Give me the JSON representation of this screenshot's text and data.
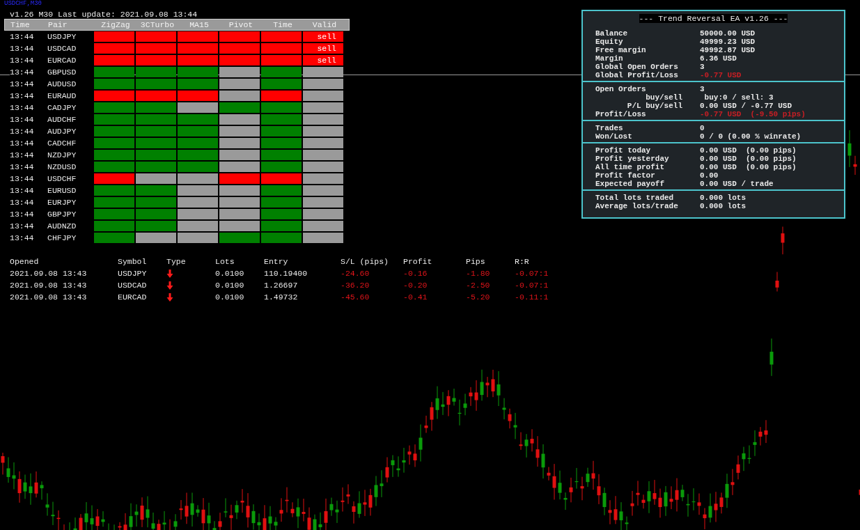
{
  "chart": {
    "symbol": "USDCHF,M30"
  },
  "signals": {
    "status": "v1.26 M30 Last update: 2021.09.08 13:44",
    "columns": [
      "Time",
      "Pair",
      "ZigZag",
      "3CTurbo",
      "MA15",
      "Pivot",
      "Time",
      "Valid"
    ],
    "rows": [
      {
        "time": "13:44",
        "pair": "USDJPY",
        "cells": [
          {
            "color": "#ff0000"
          },
          {
            "color": "#ff0000"
          },
          {
            "color": "#ff0000"
          },
          {
            "color": "#ff0000"
          },
          {
            "color": "#ff0000"
          }
        ],
        "valid": {
          "color": "#ff0000",
          "label": "sell"
        }
      },
      {
        "time": "13:44",
        "pair": "USDCAD",
        "cells": [
          {
            "color": "#ff0000"
          },
          {
            "color": "#ff0000"
          },
          {
            "color": "#ff0000"
          },
          {
            "color": "#ff0000"
          },
          {
            "color": "#ff0000"
          }
        ],
        "valid": {
          "color": "#ff0000",
          "label": "sell"
        }
      },
      {
        "time": "13:44",
        "pair": "EURCAD",
        "cells": [
          {
            "color": "#ff0000"
          },
          {
            "color": "#ff0000"
          },
          {
            "color": "#ff0000"
          },
          {
            "color": "#ff0000"
          },
          {
            "color": "#ff0000"
          }
        ],
        "valid": {
          "color": "#ff0000",
          "label": "sell"
        }
      },
      {
        "time": "13:44",
        "pair": "GBPUSD",
        "cells": [
          {
            "color": "#008000"
          },
          {
            "color": "#008000"
          },
          {
            "color": "#008000"
          },
          {
            "color": "#9a9a9a"
          },
          {
            "color": "#008000"
          }
        ],
        "valid": {
          "color": "#9a9a9a"
        }
      },
      {
        "time": "13:44",
        "pair": "AUDUSD",
        "cells": [
          {
            "color": "#008000"
          },
          {
            "color": "#008000"
          },
          {
            "color": "#008000"
          },
          {
            "color": "#9a9a9a"
          },
          {
            "color": "#008000"
          }
        ],
        "valid": {
          "color": "#9a9a9a"
        }
      },
      {
        "time": "13:44",
        "pair": "EURAUD",
        "cells": [
          {
            "color": "#ff0000"
          },
          {
            "color": "#ff0000"
          },
          {
            "color": "#ff0000"
          },
          {
            "color": "#9a9a9a"
          },
          {
            "color": "#ff0000"
          }
        ],
        "valid": {
          "color": "#9a9a9a"
        }
      },
      {
        "time": "13:44",
        "pair": "CADJPY",
        "cells": [
          {
            "color": "#008000"
          },
          {
            "color": "#008000"
          },
          {
            "color": "#9a9a9a"
          },
          {
            "color": "#008000"
          },
          {
            "color": "#008000"
          }
        ],
        "valid": {
          "color": "#9a9a9a"
        }
      },
      {
        "time": "13:44",
        "pair": "AUDCHF",
        "cells": [
          {
            "color": "#008000"
          },
          {
            "color": "#008000"
          },
          {
            "color": "#008000"
          },
          {
            "color": "#9a9a9a"
          },
          {
            "color": "#008000"
          }
        ],
        "valid": {
          "color": "#9a9a9a"
        }
      },
      {
        "time": "13:44",
        "pair": "AUDJPY",
        "cells": [
          {
            "color": "#008000"
          },
          {
            "color": "#008000"
          },
          {
            "color": "#008000"
          },
          {
            "color": "#9a9a9a"
          },
          {
            "color": "#008000"
          }
        ],
        "valid": {
          "color": "#9a9a9a"
        }
      },
      {
        "time": "13:44",
        "pair": "CADCHF",
        "cells": [
          {
            "color": "#008000"
          },
          {
            "color": "#008000"
          },
          {
            "color": "#008000"
          },
          {
            "color": "#9a9a9a"
          },
          {
            "color": "#008000"
          }
        ],
        "valid": {
          "color": "#9a9a9a"
        }
      },
      {
        "time": "13:44",
        "pair": "NZDJPY",
        "cells": [
          {
            "color": "#008000"
          },
          {
            "color": "#008000"
          },
          {
            "color": "#008000"
          },
          {
            "color": "#9a9a9a"
          },
          {
            "color": "#008000"
          }
        ],
        "valid": {
          "color": "#9a9a9a"
        }
      },
      {
        "time": "13:44",
        "pair": "NZDUSD",
        "cells": [
          {
            "color": "#008000"
          },
          {
            "color": "#008000"
          },
          {
            "color": "#008000"
          },
          {
            "color": "#9a9a9a"
          },
          {
            "color": "#008000"
          }
        ],
        "valid": {
          "color": "#9a9a9a"
        }
      },
      {
        "time": "13:44",
        "pair": "USDCHF",
        "cells": [
          {
            "color": "#ff0000"
          },
          {
            "color": "#9a9a9a"
          },
          {
            "color": "#9a9a9a"
          },
          {
            "color": "#ff0000"
          },
          {
            "color": "#ff0000"
          }
        ],
        "valid": {
          "color": "#9a9a9a"
        }
      },
      {
        "time": "13:44",
        "pair": "EURUSD",
        "cells": [
          {
            "color": "#008000"
          },
          {
            "color": "#008000"
          },
          {
            "color": "#9a9a9a"
          },
          {
            "color": "#9a9a9a"
          },
          {
            "color": "#008000"
          }
        ],
        "valid": {
          "color": "#9a9a9a"
        }
      },
      {
        "time": "13:44",
        "pair": "EURJPY",
        "cells": [
          {
            "color": "#008000"
          },
          {
            "color": "#008000"
          },
          {
            "color": "#9a9a9a"
          },
          {
            "color": "#9a9a9a"
          },
          {
            "color": "#008000"
          }
        ],
        "valid": {
          "color": "#9a9a9a"
        }
      },
      {
        "time": "13:44",
        "pair": "GBPJPY",
        "cells": [
          {
            "color": "#008000"
          },
          {
            "color": "#008000"
          },
          {
            "color": "#9a9a9a"
          },
          {
            "color": "#9a9a9a"
          },
          {
            "color": "#008000"
          }
        ],
        "valid": {
          "color": "#9a9a9a"
        }
      },
      {
        "time": "13:44",
        "pair": "AUDNZD",
        "cells": [
          {
            "color": "#008000"
          },
          {
            "color": "#008000"
          },
          {
            "color": "#9a9a9a"
          },
          {
            "color": "#9a9a9a"
          },
          {
            "color": "#008000"
          }
        ],
        "valid": {
          "color": "#9a9a9a"
        }
      },
      {
        "time": "13:44",
        "pair": "CHFJPY",
        "cells": [
          {
            "color": "#008000"
          },
          {
            "color": "#9a9a9a"
          },
          {
            "color": "#9a9a9a"
          },
          {
            "color": "#008000"
          },
          {
            "color": "#008000"
          }
        ],
        "valid": {
          "color": "#9a9a9a"
        }
      }
    ]
  },
  "orders": {
    "columns": [
      "Opened",
      "Symbol",
      "Type",
      "Lots",
      "Entry",
      "S/L (pips)",
      "Profit",
      "Pips",
      "R:R"
    ],
    "rows": [
      {
        "opened": "2021.09.08 13:43",
        "symbol": "USDJPY",
        "falling": true,
        "lots": "0.0100",
        "entry": "110.19400",
        "sl": "-24.60",
        "profit": "-0.16",
        "pips": "-1.80",
        "rr": "-0.07:1",
        "loss": true
      },
      {
        "opened": "2021.09.08 13:43",
        "symbol": "USDCAD",
        "falling": true,
        "lots": "0.0100",
        "entry": "1.26697",
        "sl": "-36.20",
        "profit": "-0.20",
        "pips": "-2.50",
        "rr": "-0.07:1",
        "loss": true
      },
      {
        "opened": "2021.09.08 13:43",
        "symbol": "EURCAD",
        "falling": true,
        "lots": "0.0100",
        "entry": "1.49732",
        "sl": "-45.60",
        "profit": "-0.41",
        "pips": "-5.20",
        "rr": "-0.11:1",
        "loss": true
      }
    ]
  },
  "ea_panel": {
    "title": "--- Trend Reversal EA v1.26 ---",
    "sections": [
      {
        "rows": [
          {
            "label": "Balance",
            "value": "50000.00 USD",
            "negative": false
          },
          {
            "label": "Equity",
            "value": "49999.23 USD",
            "negative": false
          },
          {
            "label": "Free margin",
            "value": "49992.87 USD",
            "negative": false
          },
          {
            "label": "Margin",
            "value": "6.36 USD",
            "negative": false
          },
          {
            "label": "Global Open Orders",
            "value": "3",
            "negative": false
          },
          {
            "label": "Global Profit/Loss",
            "value": "-0.77 USD",
            "negative": true
          }
        ]
      },
      {
        "rows": [
          {
            "label": "Open Orders",
            "value": "3",
            "negative": false,
            "children": [
              {
                "label": "buy/sell",
                "value": " buy:0 / sell: 3",
                "negative": false
              },
              {
                "label": "P/L buy/sell",
                "value": "0.00 USD / -0.77 USD",
                "negative": false
              }
            ]
          },
          {
            "label": "Profit/Loss",
            "value": "-0.77 USD  (-9.50 pips)",
            "negative": true
          }
        ]
      },
      {
        "rows": [
          {
            "label": "Trades",
            "value": "0",
            "negative": false
          },
          {
            "label": "Won/Lost",
            "value": "0 / 0 (0.00 % winrate)",
            "negative": false
          }
        ]
      },
      {
        "rows": [
          {
            "label": "Profit today",
            "value": "0.00 USD  (0.00 pips)",
            "negative": false
          },
          {
            "label": "Profit yesterday",
            "value": "0.00 USD  (0.00 pips)",
            "negative": false
          },
          {
            "label": "All time profit",
            "value": "0.00 USD  (0.00 pips)",
            "negative": false
          },
          {
            "label": "Profit factor",
            "value": "0.00",
            "negative": false
          },
          {
            "label": "Expected payoff",
            "value": "0.00 USD / trade",
            "negative": false
          }
        ]
      },
      {
        "rows": [
          {
            "label": "Total lots traded",
            "value": "0.000 lots",
            "negative": false
          },
          {
            "label": "Average lots/trade",
            "value": "0.000 lots",
            "negative": false
          }
        ]
      }
    ]
  }
}
